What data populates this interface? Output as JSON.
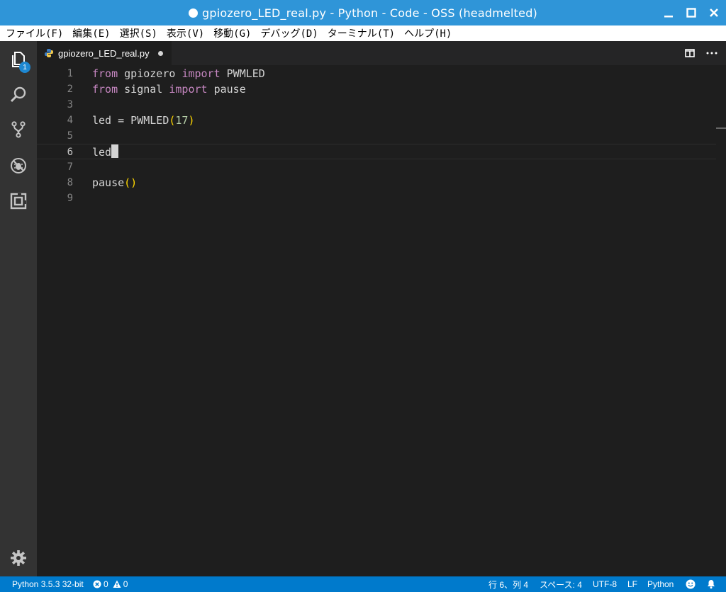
{
  "window": {
    "title": "gpiozero_LED_real.py - Python - Code - OSS (headmelted)"
  },
  "menu": [
    {
      "label": "ファイル(F)"
    },
    {
      "label": "編集(E)"
    },
    {
      "label": "選択(S)"
    },
    {
      "label": "表示(V)"
    },
    {
      "label": "移動(G)"
    },
    {
      "label": "デバッグ(D)"
    },
    {
      "label": "ターミナル(T)"
    },
    {
      "label": "ヘルプ(H)"
    }
  ],
  "activity_bar": {
    "explorer_badge": "1",
    "icons": [
      "files-icon",
      "search-icon",
      "source-control-icon",
      "debug-icon",
      "extensions-icon",
      "gear-icon"
    ]
  },
  "tab": {
    "label": "gpiozero_LED_real.py"
  },
  "editor": {
    "lines": [
      {
        "num": "1"
      },
      {
        "num": "2"
      },
      {
        "num": "3"
      },
      {
        "num": "4"
      },
      {
        "num": "5"
      },
      {
        "num": "6"
      },
      {
        "num": "7"
      },
      {
        "num": "8"
      },
      {
        "num": "9"
      }
    ],
    "tokens": {
      "l1_kw1": "from",
      "l1_mod": " gpiozero ",
      "l1_kw2": "import",
      "l1_name": " PWMLED",
      "l2_kw1": "from",
      "l2_mod": " signal ",
      "l2_kw2": "import",
      "l2_name": " pause",
      "l4_a": "led = PWMLED",
      "l4_p1": "(",
      "l4_num": "17",
      "l4_p2": ")",
      "l6_a": "led",
      "l8_a": "pause",
      "l8_p": "()"
    }
  },
  "status_bar": {
    "interpreter": "Python 3.5.3 32-bit",
    "errors": "0",
    "warnings": "0",
    "position": "行 6、列 4",
    "indent": "スペース: 4",
    "encoding": "UTF-8",
    "eol": "LF",
    "language": "Python"
  },
  "colors": {
    "titlebar": "#2f95d8",
    "statusbar": "#007acc",
    "keyword": "#c586c0",
    "paren": "#ffd700"
  }
}
